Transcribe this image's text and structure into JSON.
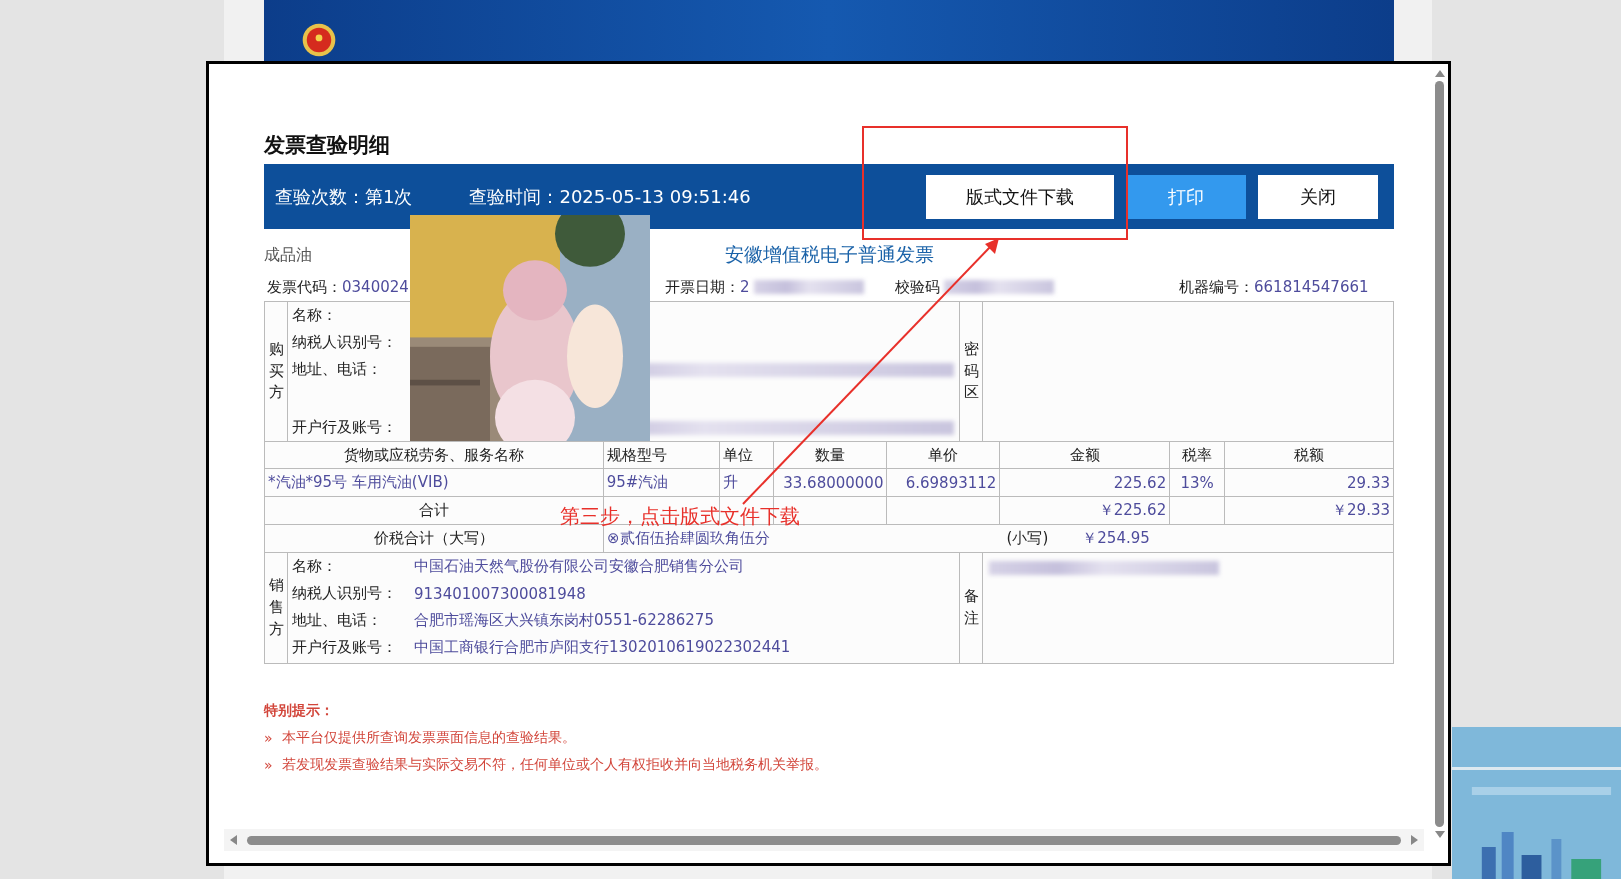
{
  "dialog": {
    "title": "发票查验明细",
    "check_count": "查验次数：第1次",
    "check_time": "查验时间：2025-05-13 09:51:46",
    "buttons": [
      {
        "label": "版式文件下载",
        "primary": false
      },
      {
        "label": "打印",
        "primary": true
      },
      {
        "label": "关闭",
        "primary": false
      }
    ]
  },
  "invoice": {
    "category": "成品油",
    "title": "安徽增值税电子普通发票",
    "info": [
      {
        "label": "发票代码：",
        "value": "0340024",
        "blurred": false
      },
      {
        "label": "开票日期：",
        "value": "2",
        "blurred": true
      },
      {
        "label": "校验码",
        "blurred": true
      },
      {
        "label": "机器编号：",
        "value": "661814547661",
        "blurred": false
      }
    ],
    "buyer": {
      "side_label": "购买方",
      "fields": [
        {
          "label": "名称：",
          "blurred": false
        },
        {
          "label": "纳税人识别号：",
          "blurred": false
        },
        {
          "label": "地址、电话：",
          "blurred": true
        },
        {
          "label": "开户行及账号：",
          "blurred": true
        }
      ],
      "cipher_label": "密码区"
    },
    "items": {
      "columns": [
        "货物或应税劳务、服务名称",
        "规格型号",
        "单位",
        "数量",
        "单价",
        "金额",
        "税率",
        "税额"
      ],
      "rows": [
        [
          "*汽油*95号 车用汽油(VIB)",
          "95#汽油",
          "升",
          "33.68000000",
          "6.69893112",
          "225.62",
          "13%",
          "29.33"
        ]
      ],
      "total": {
        "label": "合计",
        "amount": "￥225.62",
        "tax": "￥29.33"
      }
    },
    "grand_total": {
      "label": "价税合计（大写）",
      "words": "⊗贰佰伍拾肆圆玖角伍分",
      "small_label": "(小写)",
      "amount": "￥254.95"
    },
    "seller": {
      "side_label": "销售方",
      "fields": [
        {
          "label": "名称：",
          "value": "中国石油天然气股份有限公司安徽合肥销售分公司"
        },
        {
          "label": "纳税人识别号：",
          "value": "913401007300081948"
        },
        {
          "label": "地址、电话：",
          "value": "合肥市瑶海区大兴镇东岗村0551-62286275"
        },
        {
          "label": "开户行及账号：",
          "value": "中国工商银行合肥市庐阳支行1302010619022302441"
        }
      ],
      "remarks_label": "备注",
      "remarks_blurred": true
    }
  },
  "notes": {
    "title": "特别提示：",
    "items": [
      {
        "marker": "»",
        "text": "本平台仅提供所查询发票票面信息的查验结果。"
      },
      {
        "marker": "»",
        "text": "若发现发票查验结果与实际交易不符，任何单位或个人有权拒收并向当地税务机关举报。"
      }
    ]
  },
  "annotation": {
    "text": "第三步，点击版式文件下载"
  }
}
